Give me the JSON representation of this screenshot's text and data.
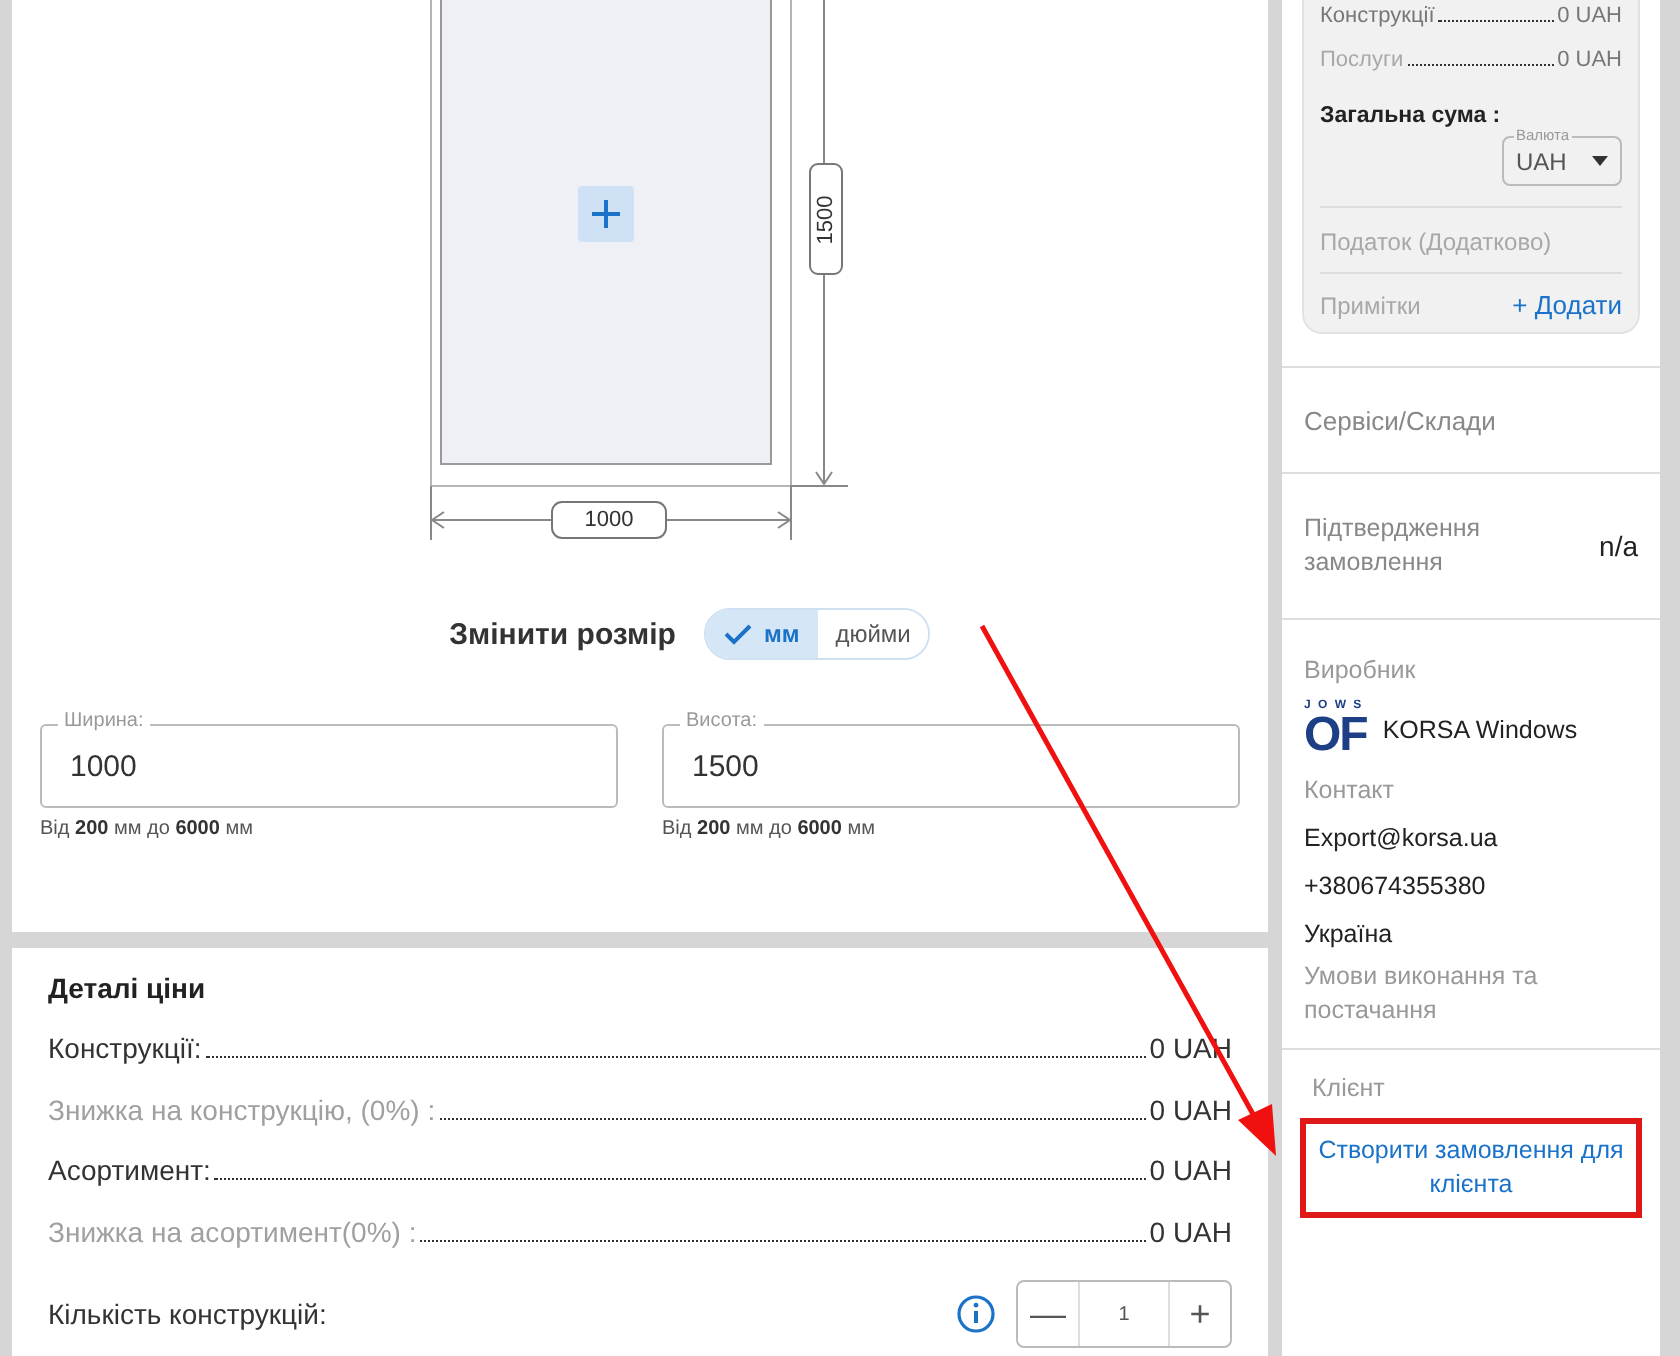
{
  "drawing": {
    "width_label": "1000",
    "height_label": "1500"
  },
  "resize": {
    "label": "Змінити розмір",
    "units": [
      {
        "label": "мм",
        "selected": true
      },
      {
        "label": "дюйми",
        "selected": false
      }
    ]
  },
  "fields": [
    {
      "label": "Ширина:",
      "value": "1000",
      "hint": "Від **200** мм до **6000** мм"
    },
    {
      "label": "Висота:",
      "value": "1500",
      "hint": "Від **200** мм до **6000** мм"
    }
  ],
  "price_details": {
    "title": "Деталі ціни",
    "rows": [
      {
        "label": "Конструкції:",
        "value": "0 UAH",
        "muted": false
      },
      {
        "label": "Знижка на конструкцію, (0%) :",
        "value": "0 UAH",
        "muted": true
      },
      {
        "label": "Асортимент:",
        "value": "0 UAH",
        "muted": false
      },
      {
        "label": "Знижка на асортимент(0%) :",
        "value": "0 UAH",
        "muted": true
      }
    ],
    "quantity": {
      "label": "Кількість конструкцій:",
      "minus": "—",
      "value": "1",
      "plus": "+"
    }
  },
  "summary": {
    "rows": [
      {
        "label": "Конструкції",
        "value": "0 UAH"
      },
      {
        "label": "Послуги",
        "value": "0 UAH"
      }
    ],
    "total_label": "Загальна сума :",
    "currency": {
      "label": "Валюта",
      "value": "UAH"
    },
    "tax": "Податок (Додатково)",
    "notes": "Примітки",
    "add": "+ Додати"
  },
  "services": "Сервіси/Склади",
  "confirmation": {
    "label": "Підтвердження замовлення",
    "value": "n/a"
  },
  "manufacturer": {
    "heading": "Виробник",
    "logo_top": "J O W S",
    "logo_main": "OF",
    "name": "KORSA Windows",
    "contact_heading": "Контакт",
    "email": "Export@korsa.ua",
    "phone": "+380674355380",
    "country": "Україна",
    "terms": "Умови виконання та постачання"
  },
  "client": {
    "heading": "Клієнт",
    "button": "Створити замовлення для клієнта",
    "highlighted": true
  },
  "annotation": {
    "arrow": true
  }
}
